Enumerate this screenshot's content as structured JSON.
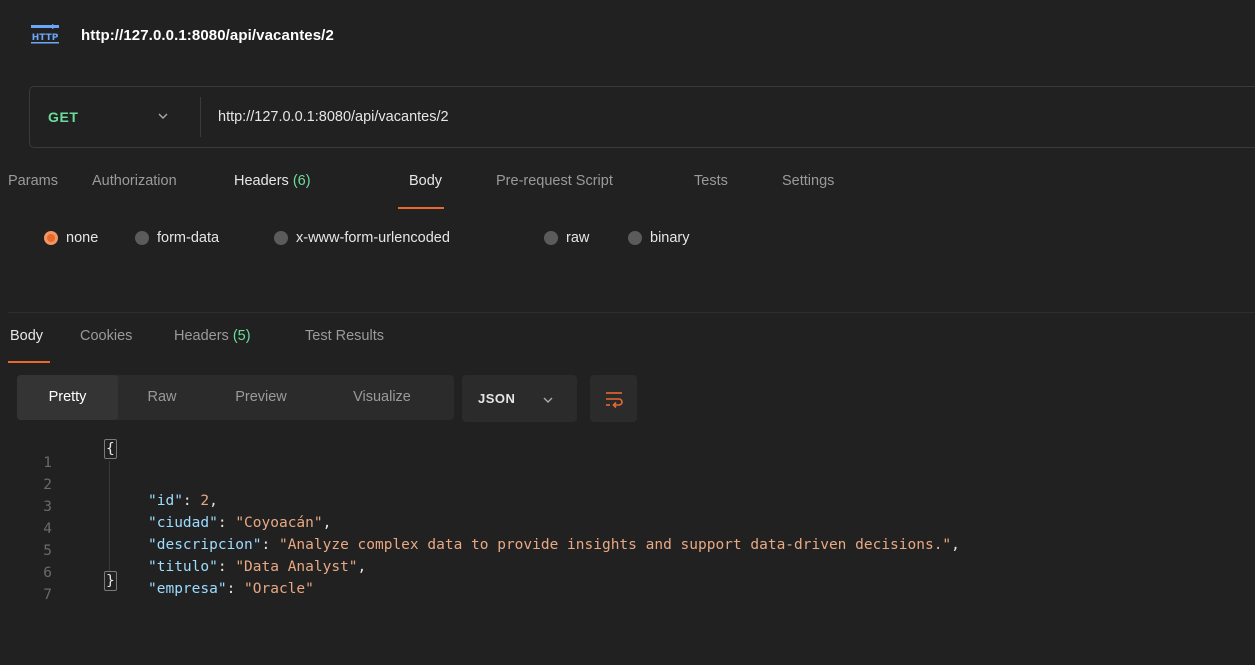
{
  "title_bar": {
    "icon": "http-request-icon",
    "title": "http://127.0.0.1:8080/api/vacantes/2"
  },
  "request": {
    "method": "GET",
    "url": "http://127.0.0.1:8080/api/vacantes/2"
  },
  "request_tabs": [
    {
      "label": "Params"
    },
    {
      "label": "Authorization"
    },
    {
      "label": "Headers",
      "count": "(6)"
    },
    {
      "label": "Body",
      "active": true
    },
    {
      "label": "Pre-request Script"
    },
    {
      "label": "Tests"
    },
    {
      "label": "Settings"
    }
  ],
  "body_types": [
    {
      "label": "none",
      "selected": true
    },
    {
      "label": "form-data"
    },
    {
      "label": "x-www-form-urlencoded"
    },
    {
      "label": "raw"
    },
    {
      "label": "binary"
    }
  ],
  "response_tabs": [
    {
      "label": "Body",
      "active": true
    },
    {
      "label": "Cookies"
    },
    {
      "label": "Headers",
      "count": "(5)"
    },
    {
      "label": "Test Results"
    }
  ],
  "view_modes": [
    {
      "label": "Pretty",
      "active": true
    },
    {
      "label": "Raw"
    },
    {
      "label": "Preview"
    },
    {
      "label": "Visualize"
    }
  ],
  "format": "JSON",
  "colors": {
    "accent": "#e8692e",
    "method_green": "#6bdd9a",
    "json_key": "#9cdcfe",
    "json_value": "#e8a883",
    "background": "#212121"
  },
  "response_body": {
    "line_numbers": [
      "1",
      "2",
      "3",
      "4",
      "5",
      "6",
      "7"
    ],
    "open_brace": "{",
    "close_brace": "}",
    "fields": [
      {
        "key": "\"id\"",
        "value": "2",
        "kind": "number",
        "comma": ","
      },
      {
        "key": "\"ciudad\"",
        "value": "\"Coyoacán\"",
        "kind": "string",
        "comma": ","
      },
      {
        "key": "\"descripcion\"",
        "value": "\"Analyze complex data to provide insights and support data-driven decisions.\"",
        "kind": "string",
        "comma": ","
      },
      {
        "key": "\"titulo\"",
        "value": "\"Data Analyst\"",
        "kind": "string",
        "comma": ","
      },
      {
        "key": "\"empresa\"",
        "value": "\"Oracle\"",
        "kind": "string",
        "comma": ""
      }
    ]
  }
}
